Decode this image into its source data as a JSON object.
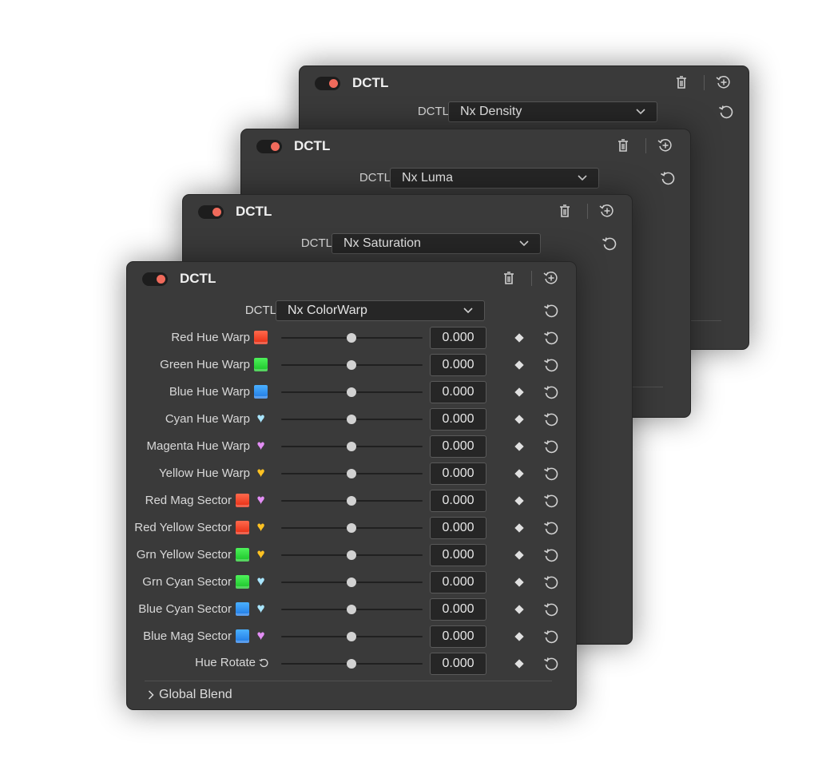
{
  "stack_panels": [
    {
      "title": "DCTL",
      "dctl_label": "DCTL",
      "dctl_value": "Nx Density"
    },
    {
      "title": "DCTL",
      "dctl_label": "DCTL",
      "dctl_value": "Nx Luma"
    },
    {
      "title": "DCTL",
      "dctl_label": "DCTL",
      "dctl_value": "Nx Saturation"
    }
  ],
  "front": {
    "title": "DCTL",
    "dctl_label": "DCTL",
    "dctl_value": "Nx ColorWarp",
    "params": [
      {
        "label": "Red Hue Warp",
        "value": "0.000"
      },
      {
        "label": "Green Hue Warp",
        "value": "0.000"
      },
      {
        "label": "Blue Hue Warp",
        "value": "0.000"
      },
      {
        "label": "Cyan Hue Warp",
        "value": "0.000"
      },
      {
        "label": "Magenta Hue Warp",
        "value": "0.000"
      },
      {
        "label": "Yellow Hue Warp",
        "value": "0.000"
      },
      {
        "label": "Red Mag Sector",
        "value": "0.000"
      },
      {
        "label": "Red Yellow Sector",
        "value": "0.000"
      },
      {
        "label": "Grn Yellow Sector",
        "value": "0.000"
      },
      {
        "label": "Grn Cyan Sector",
        "value": "0.000"
      },
      {
        "label": "Blue Cyan Sector",
        "value": "0.000"
      },
      {
        "label": "Blue Mag Sector",
        "value": "0.000"
      },
      {
        "label": "Hue Rotate",
        "value": "0.000"
      }
    ],
    "global_blend": "Global Blend"
  },
  "colors": {
    "panel_bg": "#3a3a3a",
    "field_bg": "#262626",
    "toggle_on": "#f06a5b",
    "red_swatch": "#e62a10",
    "green_swatch": "#19c227",
    "blue_swatch": "#1f78e3",
    "cyan_heart": "#a9e6ff",
    "magenta_heart": "#e38ef5",
    "yellow_heart": "#ffc222"
  },
  "icons": [
    "trash-icon",
    "add-node-icon",
    "reset-icon",
    "keyframe-diamond-icon",
    "chevron-down-icon",
    "chevron-right-icon",
    "hue-rotate-icon"
  ]
}
